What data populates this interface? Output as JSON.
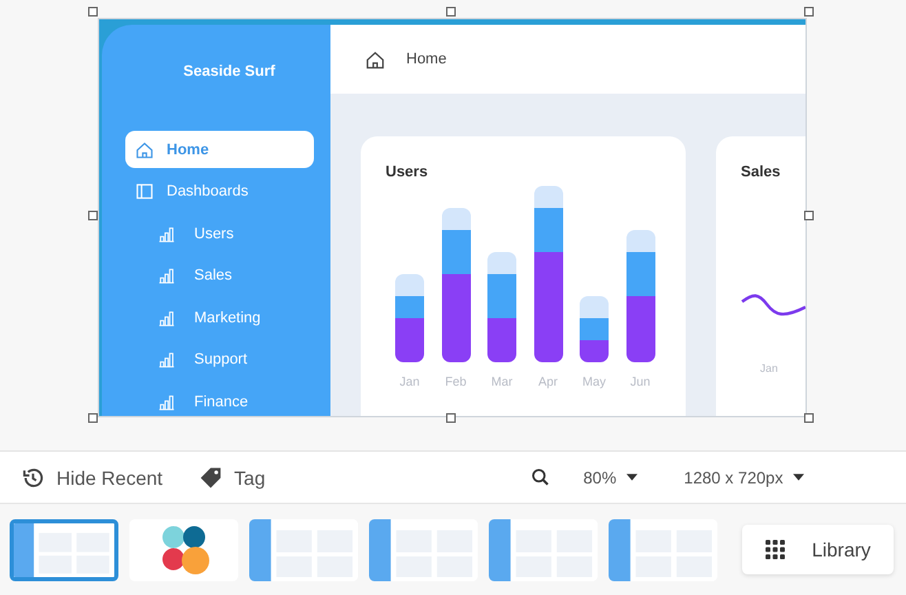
{
  "canvas": {
    "sidebar": {
      "brand": "Seaside Surf",
      "items": [
        {
          "label": "Home",
          "kind": "home",
          "selected": true
        },
        {
          "label": "Dashboards",
          "kind": "panel",
          "selected": false,
          "children": [
            {
              "label": "Users",
              "kind": "chart",
              "selected": false
            },
            {
              "label": "Sales",
              "kind": "chart",
              "selected": false
            },
            {
              "label": "Marketing",
              "kind": "chart",
              "selected": false
            },
            {
              "label": "Support",
              "kind": "chart",
              "selected": false
            },
            {
              "label": "Finance",
              "kind": "chart",
              "selected": false
            }
          ]
        }
      ]
    },
    "header": {
      "title": "Home"
    },
    "users_card": {
      "title": "Users",
      "months": [
        "Jan",
        "Feb",
        "Mar",
        "Apr",
        "May",
        "Jun"
      ]
    },
    "sales_card": {
      "title": "Sales",
      "months": [
        "Jan"
      ]
    }
  },
  "toolbar": {
    "hide_recent": "Hide Recent",
    "tag": "Tag",
    "zoom": "80%",
    "size": "1280 x 720px"
  },
  "thumbnails": [
    {
      "kind": "dashboard",
      "selected": true
    },
    {
      "kind": "logo",
      "selected": false
    },
    {
      "kind": "dashboard",
      "selected": false
    },
    {
      "kind": "dashboard",
      "selected": false
    },
    {
      "kind": "dashboard",
      "selected": false
    },
    {
      "kind": "dashboard",
      "selected": false
    }
  ],
  "library_button": "Library"
}
